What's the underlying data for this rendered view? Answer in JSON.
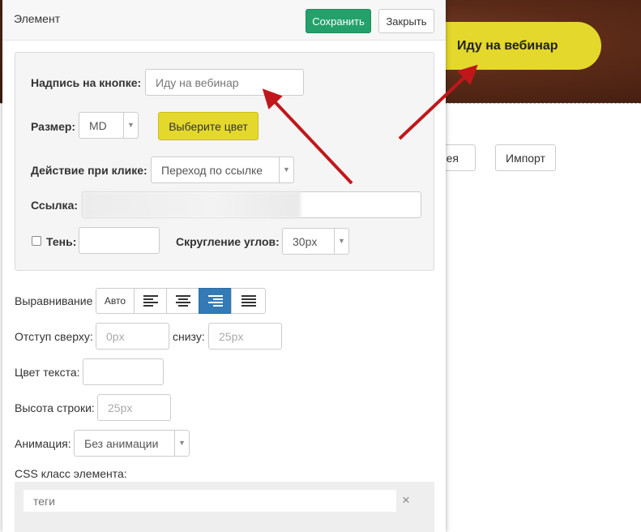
{
  "background": {
    "hero_button_label": "Иду на вебинар",
    "gallery_button_label": "ерея",
    "import_button_label": "Импорт"
  },
  "dialog": {
    "title": "Элемент",
    "save_label": "Сохранить",
    "close_label": "Закрыть"
  },
  "panel": {
    "caption_label": "Надпись на кнопке:",
    "caption_value": "Иду на вебинар",
    "size_label": "Размер:",
    "size_value": "MD",
    "color_button_label": "Выберите цвет",
    "action_label": "Действие при клике:",
    "action_value": "Переход по ссылке",
    "link_label": "Ссылка:",
    "link_value": "",
    "shadow_label": "Тень:",
    "shadow_value": "",
    "radius_label": "Скругление углов:",
    "radius_value": "30px"
  },
  "settings": {
    "align_label": "Выравнивание",
    "align_auto_label": "Авто",
    "align_options": [
      "left-icon",
      "center-icon",
      "right-icon",
      "justify-icon"
    ],
    "align_selected": "right-icon",
    "margin_top_label": "Отступ сверху:",
    "margin_top_placeholder": "0px",
    "margin_bottom_label": "снизу:",
    "margin_bottom_placeholder": "25px",
    "text_color_label": "Цвет текста:",
    "line_height_label": "Высота строки:",
    "line_height_placeholder": "25px",
    "animation_label": "Анимация:",
    "animation_value": "Без анимации",
    "css_class_label": "CSS класс элемента:",
    "tags_placeholder": "теги",
    "tags_clear": "×"
  },
  "colors": {
    "accent_yellow": "#e4d82c",
    "save_green": "#24a16b",
    "active_blue": "#337ab7",
    "arrow_red": "#c0171b"
  }
}
